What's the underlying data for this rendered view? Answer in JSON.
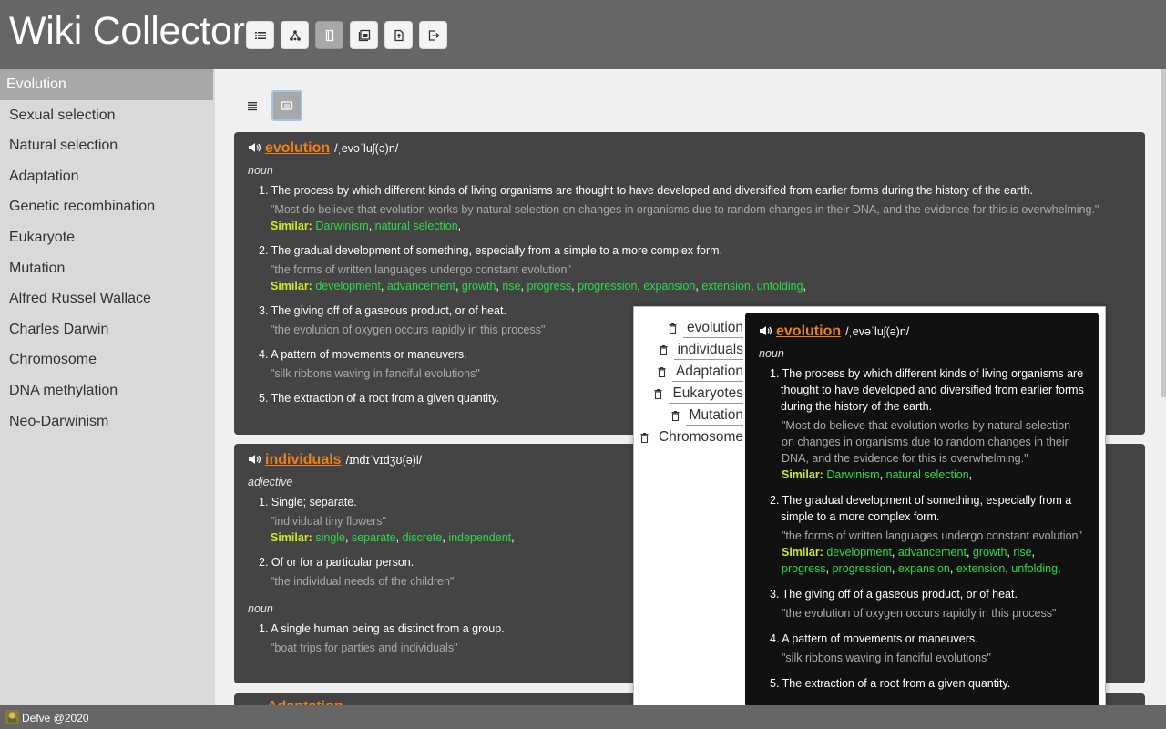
{
  "app": {
    "title": "Wiki Collector"
  },
  "toolbar": {
    "buttons": [
      {
        "icon": "list-icon"
      },
      {
        "icon": "tree-icon"
      },
      {
        "icon": "notebook-icon",
        "active": true
      },
      {
        "icon": "gallery-icon"
      },
      {
        "icon": "export-file-icon"
      },
      {
        "icon": "logout-icon"
      }
    ]
  },
  "sidebar": {
    "items": [
      {
        "label": "Evolution",
        "active": true
      },
      {
        "label": "Sexual selection"
      },
      {
        "label": "Natural selection"
      },
      {
        "label": "Adaptation"
      },
      {
        "label": "Genetic recombination"
      },
      {
        "label": "Eukaryote"
      },
      {
        "label": "Mutation"
      },
      {
        "label": "Alfred Russel Wallace"
      },
      {
        "label": "Charles Darwin"
      },
      {
        "label": "Chromosome"
      },
      {
        "label": "DNA methylation"
      },
      {
        "label": "Neo-Darwinism"
      }
    ]
  },
  "view": {
    "buttons": [
      {
        "icon": "list-view-icon"
      },
      {
        "icon": "card-view-icon",
        "active": true
      }
    ]
  },
  "entries": [
    {
      "word": "evolution",
      "phonetic": "/ˌevəˈluʃ(ə)n/",
      "pos": "noun",
      "defs": [
        {
          "num": "1",
          "text": "The process by which different kinds of living organisms are thought to have developed and diversified from earlier forms during the history of the earth.",
          "example": "\"Most do believe that evolution works by natural selection on changes in organisms due to random changes in their DNA, and the evidence for this is overwhelming.\"",
          "similar_label": "Similar:",
          "similar": [
            "Darwinism",
            "natural selection"
          ]
        },
        {
          "num": "2",
          "text": "The gradual development of something, especially from a simple to a more complex form.",
          "example": "\"the forms of written languages undergo constant evolution\"",
          "similar_label": "Similar:",
          "similar": [
            "development",
            "advancement",
            "growth",
            "rise",
            "progress",
            "progression",
            "expansion",
            "extension",
            "unfolding"
          ]
        },
        {
          "num": "3",
          "text": "The giving off of a gaseous product, or of heat.",
          "example": "\"the evolution of oxygen occurs rapidly in this process\""
        },
        {
          "num": "4",
          "text": "A pattern of movements or maneuvers.",
          "example": "\"silk ribbons waving in fanciful evolutions\""
        },
        {
          "num": "5",
          "text": "The extraction of a root from a given quantity."
        }
      ]
    },
    {
      "word": "individuals",
      "phonetic": "/ɪndɪˈvɪdʒʊ(ə)l/",
      "pos1": "adjective",
      "defs1": [
        {
          "num": "1",
          "text": "Single; separate.",
          "example": "\"individual tiny flowers\"",
          "similar_label": "Similar:",
          "similar": [
            "single",
            "separate",
            "discrete",
            "independent"
          ]
        },
        {
          "num": "2",
          "text": "Of or for a particular person.",
          "example": "\"the individual needs of the children\""
        }
      ],
      "pos2": "noun",
      "defs2": [
        {
          "num": "1",
          "text": "A single human being as distinct from a group.",
          "example": "\"boat trips for parties and individuals\""
        }
      ]
    },
    {
      "word": "Adaptation"
    }
  ],
  "popup": {
    "list": [
      "evolution",
      "individuals",
      "Adaptation",
      "Eukaryotes",
      "Mutation",
      "Chromosome"
    ],
    "entry": {
      "word": "evolution",
      "phonetic": "/ˌevəˈluʃ(ə)n/",
      "pos": "noun",
      "defs": [
        {
          "num": "1",
          "text": "The process by which different kinds of living organisms are thought to have developed and diversified from earlier forms during the history of the earth.",
          "example": "\"Most do believe that evolution works by natural selection on changes in organisms due to random changes in their DNA, and the evidence for this is overwhelming.\"",
          "similar_label": "Similar:",
          "similar": [
            "Darwinism",
            "natural selection"
          ]
        },
        {
          "num": "2",
          "text": "The gradual development of something, especially from a simple to a more complex form.",
          "example": "\"the forms of written languages undergo constant evolution\"",
          "similar_label": "Similar:",
          "similar": [
            "development",
            "advancement",
            "growth",
            "rise",
            "progress",
            "progression",
            "expansion",
            "extension",
            "unfolding"
          ]
        },
        {
          "num": "3",
          "text": "The giving off of a gaseous product, or of heat.",
          "example": "\"the evolution of oxygen occurs rapidly in this process\""
        },
        {
          "num": "4",
          "text": "A pattern of movements or maneuvers.",
          "example": "\"silk ribbons waving in fanciful evolutions\""
        },
        {
          "num": "5",
          "text": "The extraction of a root from a given quantity."
        }
      ]
    }
  },
  "footer": {
    "text": "Defve @2020"
  },
  "colors": {
    "accent_word": "#f07f1a",
    "similar_label": "#d0e82a",
    "synonym": "#2fd94a",
    "header_bg": "#666666",
    "card_bg": "#444444"
  }
}
